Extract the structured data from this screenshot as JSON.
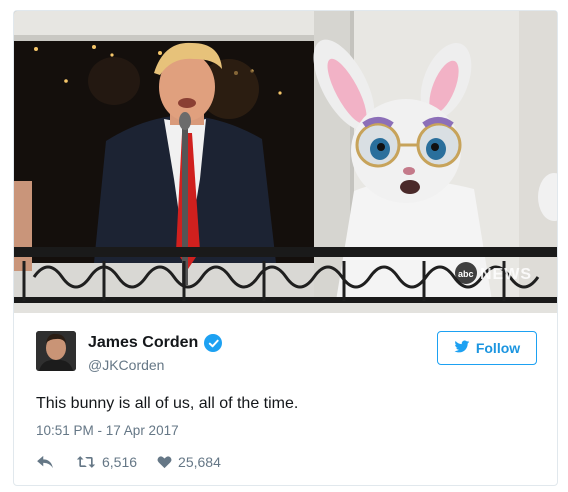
{
  "tweet": {
    "author_name": "James Corden",
    "author_handle": "@JKCorden",
    "follow_label": "Follow",
    "text": "This bunny is all of us, all of the time.",
    "timestamp": "10:51 PM - 17 Apr 2017",
    "retweets": "6,516",
    "likes": "25,684",
    "media_watermark": "abcNEWS"
  },
  "colors": {
    "accent": "#1da1f2",
    "text": "#14171a",
    "muted": "#657786",
    "border": "#e1e8ed"
  },
  "icons": {
    "verified": "verified-badge-icon",
    "follow": "twitter-bird-icon",
    "reply": "reply-icon",
    "retweet": "retweet-icon",
    "like": "heart-icon"
  }
}
